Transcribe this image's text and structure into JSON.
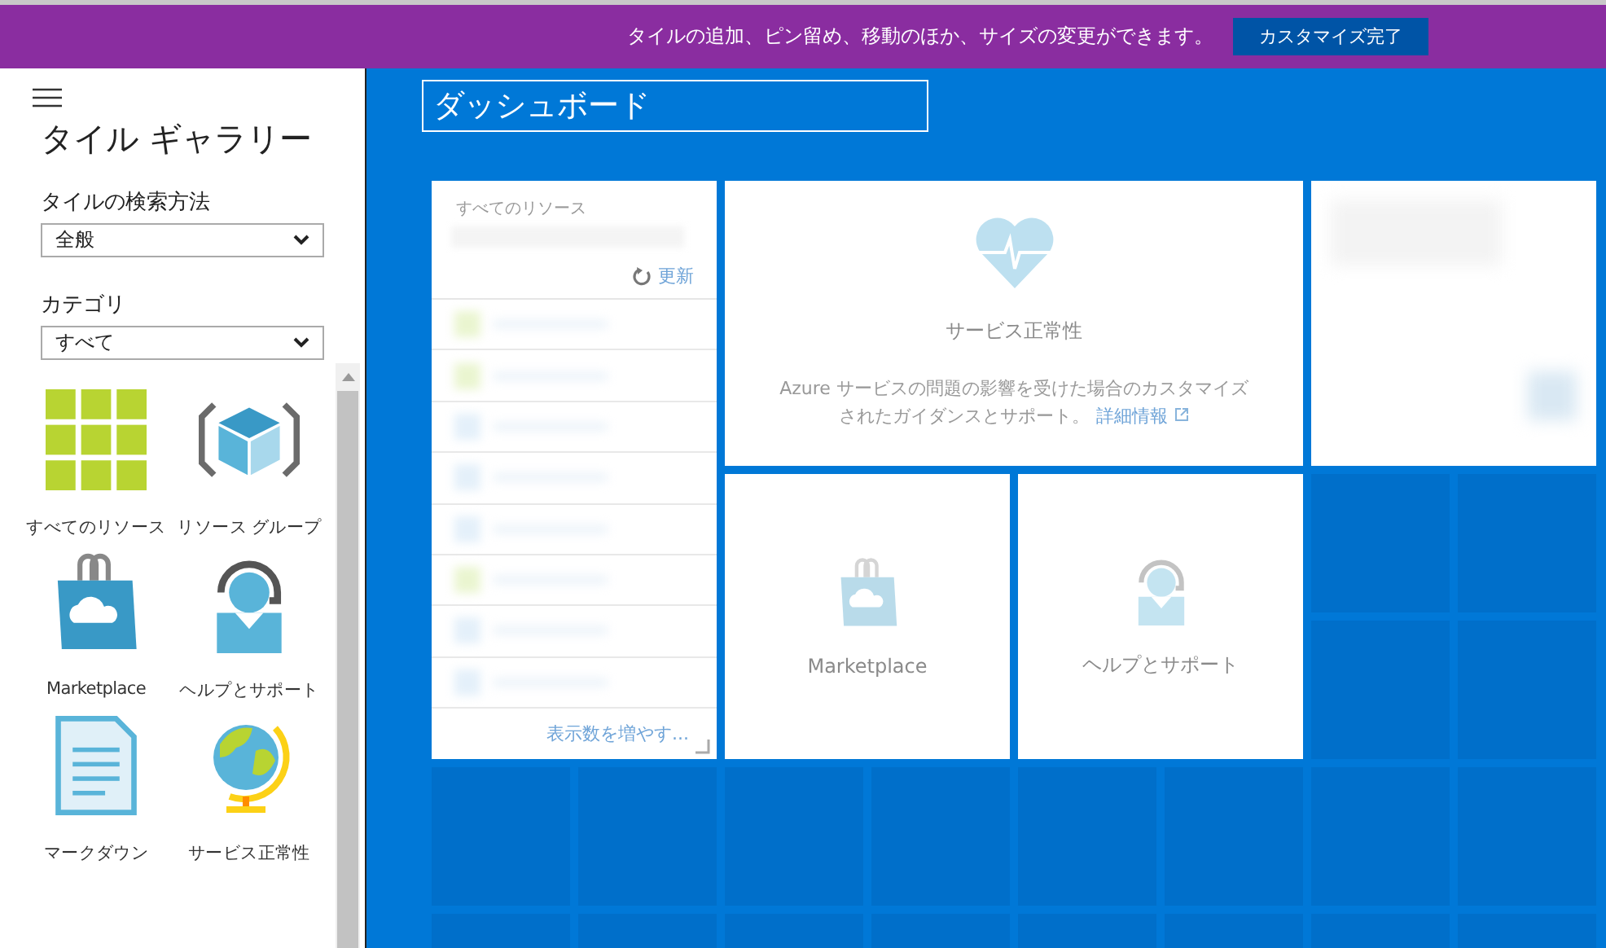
{
  "banner": {
    "message": "タイルの追加、ピン留め、移動のほか、サイズの変更ができます。",
    "button": "カスタマイズ完了"
  },
  "gallery": {
    "title": "タイル ギャラリー",
    "search_method": {
      "label": "タイルの検索方法",
      "value": "全般"
    },
    "category": {
      "label": "カテゴリ",
      "value": "すべて"
    },
    "tiles": [
      {
        "label": "すべてのリソース",
        "kind": "grid"
      },
      {
        "label": "リソース グループ",
        "kind": "cube"
      },
      {
        "label": "Marketplace",
        "kind": "bag"
      },
      {
        "label": "ヘルプとサポート",
        "kind": "help"
      },
      {
        "label": "マークダウン",
        "kind": "document"
      },
      {
        "label": "サービス正常性",
        "kind": "globe"
      }
    ]
  },
  "dashboard": {
    "title": "ダッシュボード",
    "tiles": [
      {
        "kind": "resources",
        "title": "すべてのリソース",
        "refresh": "更新",
        "more": "表示数を増やす..."
      },
      {
        "kind": "health",
        "title": "サービス正常性",
        "description": "Azure サービスの問題の影響を受けた場合のカスタマイズされたガイダンスとサポート。",
        "link": "詳細情報"
      },
      {
        "kind": "blurred"
      },
      {
        "kind": "marketplace",
        "title": "Marketplace"
      },
      {
        "kind": "help",
        "title": "ヘルプとサポート"
      }
    ]
  }
}
